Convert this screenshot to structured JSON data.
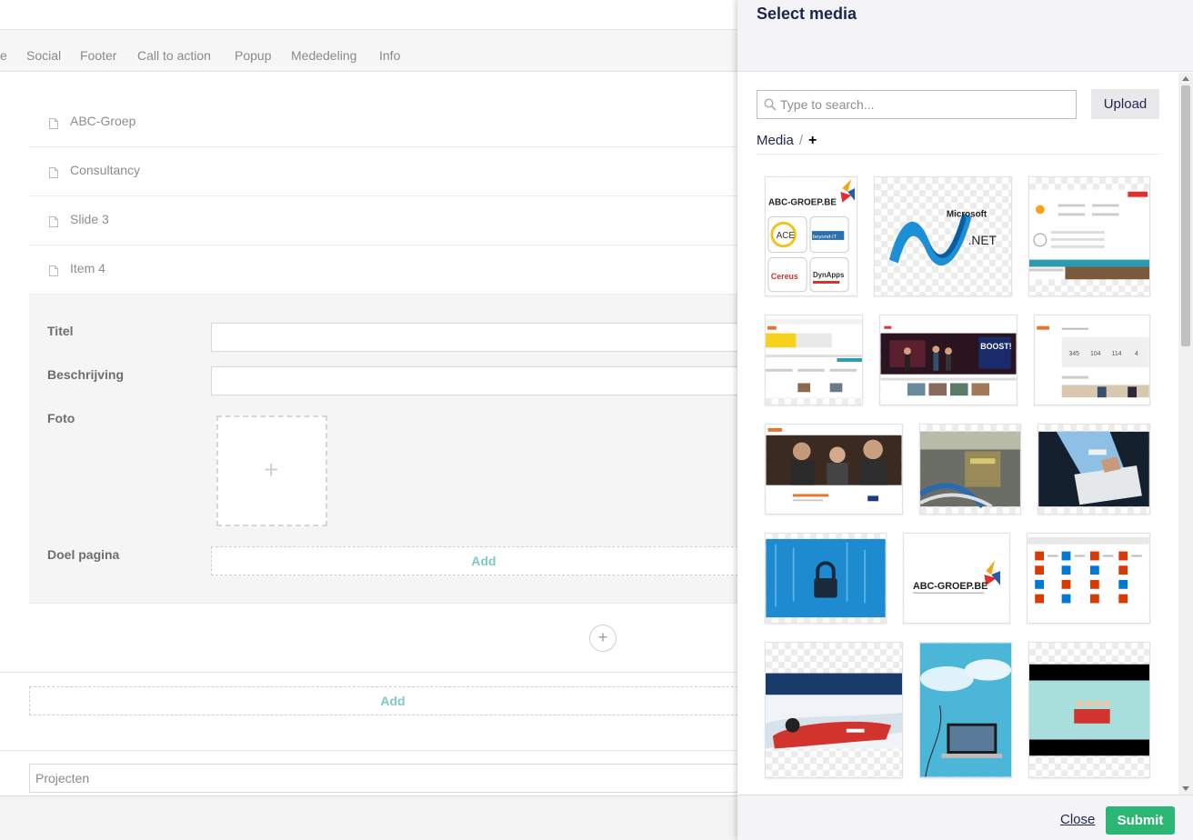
{
  "tabs": [
    "e",
    "Social",
    "Footer",
    "Call to action",
    "Popup",
    "Mededeling",
    "Info"
  ],
  "list_items": [
    "ABC-Groep",
    "Consultancy",
    "Slide 3",
    "Item 4"
  ],
  "editor": {
    "titel_label": "Titel",
    "beschrijving_label": "Beschrijving",
    "foto_label": "Foto",
    "doel_label": "Doel pagina",
    "doel_add": "Add",
    "photo_plus": "+"
  },
  "circle_add": "+",
  "add_block": "Add",
  "projecten_placeholder": "Projecten",
  "panel": {
    "title": "Select media",
    "search_placeholder": "Type to search...",
    "upload_label": "Upload",
    "breadcrumb_root": "Media",
    "breadcrumb_sep": "/",
    "breadcrumb_add": "+",
    "close_label": "Close",
    "submit_label": "Submit"
  },
  "media_logos": {
    "abc_text": "ABC-GROEP.BE",
    "ace": "ACE",
    "beyond": "beyond-IT",
    "cereus": "Cereus",
    "dynapps": "DynApps",
    "ms": "Microsoft",
    "net": ".NET",
    "boost": "BOOST!"
  },
  "colors": {
    "accent_teal": "#7ec8c8",
    "submit_green": "#2bb673",
    "title_navy": "#1b264f"
  }
}
